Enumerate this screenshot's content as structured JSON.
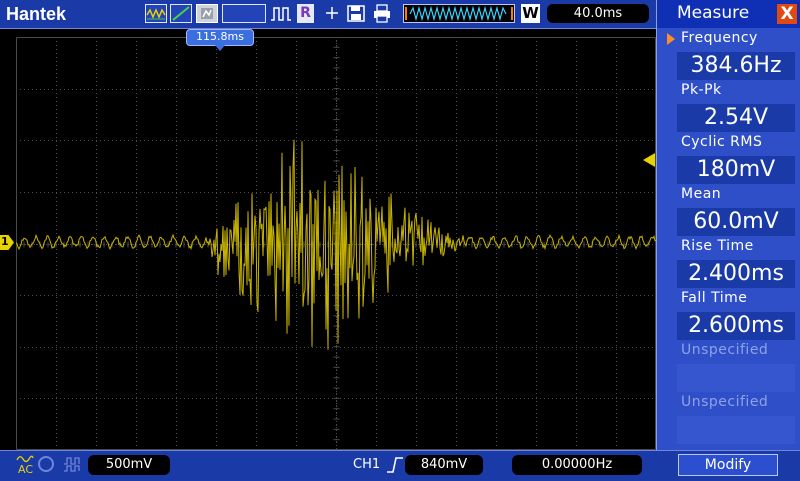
{
  "toolbar": {
    "brand": "Hantek",
    "mode_letter": "R",
    "wave_letter": "W",
    "timebase": "40.0ms",
    "icons": [
      "wave-icon",
      "slope-icon",
      "persist-icon",
      "pulse-icon",
      "save-icon",
      "print-icon"
    ]
  },
  "trigger_position": "115.8ms",
  "channel_marker": "1",
  "bottom": {
    "coupling": "AC",
    "volts_div": "500mV",
    "trigger_channel": "CH1",
    "trigger_level": "840mV",
    "frequency": "0.00000Hz"
  },
  "measure": {
    "title": "Measure",
    "close": "X",
    "items": [
      {
        "label": "Frequency",
        "value": "384.6Hz"
      },
      {
        "label": "Pk-Pk",
        "value": "2.54V"
      },
      {
        "label": "Cyclic RMS",
        "value": "180mV"
      },
      {
        "label": "Mean",
        "value": "60.0mV"
      },
      {
        "label": "Rise Time",
        "value": "2.400ms"
      },
      {
        "label": "Fall Time",
        "value": "2.600ms"
      },
      {
        "label": "Unspecified",
        "value": ""
      },
      {
        "label": "Unspecified",
        "value": ""
      }
    ],
    "modify": "Modify"
  },
  "colors": {
    "trace": "#c8b400",
    "grid": "#4a4a4a",
    "panel": "#2f4fc9",
    "bar": "#1a3aa8"
  }
}
